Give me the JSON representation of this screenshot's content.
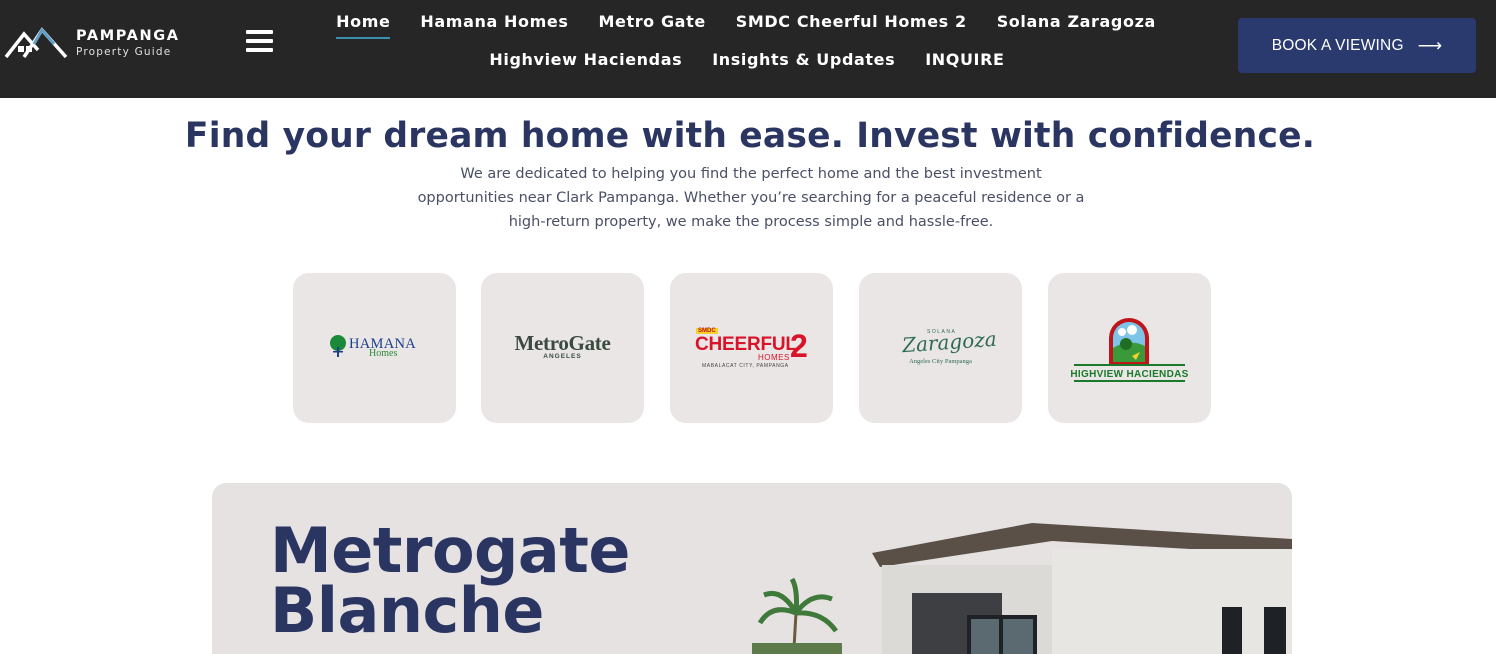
{
  "header": {
    "logo": {
      "title": "PAMPANGA",
      "subtitle": "Property Guide"
    },
    "nav_row1": [
      {
        "label": "Home",
        "active": true
      },
      {
        "label": "Hamana Homes"
      },
      {
        "label": "Metro Gate"
      },
      {
        "label": "SMDC Cheerful Homes 2"
      },
      {
        "label": "Solana Zaragoza"
      }
    ],
    "nav_row2": [
      {
        "label": "Highview Haciendas"
      },
      {
        "label": "Insights & Updates"
      },
      {
        "label": "INQUIRE"
      }
    ],
    "book_button": {
      "label": "BOOK A VIEWING",
      "icon": "arrow-right-icon"
    }
  },
  "hero": {
    "title": "Find your dream home with ease. Invest with confidence.",
    "line1": "We are dedicated to helping you find the perfect home and the best investment",
    "line2": "opportunities near Clark Pampanga. Whether you’re searching for a peaceful residence or a",
    "line3": "high-return property, we make the process simple and hassle-free."
  },
  "brands": {
    "hamana": {
      "name": "HAMANA",
      "sub": "Homes"
    },
    "metrogate": {
      "name": "MetroGate",
      "sub": "ANGELES"
    },
    "cheerful": {
      "tag": "SMDC",
      "name": "CHEERFUL",
      "number": "2",
      "homes": "HOMES",
      "city": "MABALACAT CITY, PAMPANGA"
    },
    "solana": {
      "top": "SOLANA",
      "name": "Zaragoza",
      "sub": "Angeles City Pampanga"
    },
    "highview": {
      "name": "HIGHVIEW HACIENDAS"
    }
  },
  "feature": {
    "title_line1": "Metrogate",
    "title_line2": "Blanche"
  },
  "colors": {
    "header_bg": "#262626",
    "accent_navy": "#2a3562",
    "button_bg": "#2a3a6e",
    "card_bg": "#e9e6e5",
    "active_underline": "#3d8fb0"
  }
}
